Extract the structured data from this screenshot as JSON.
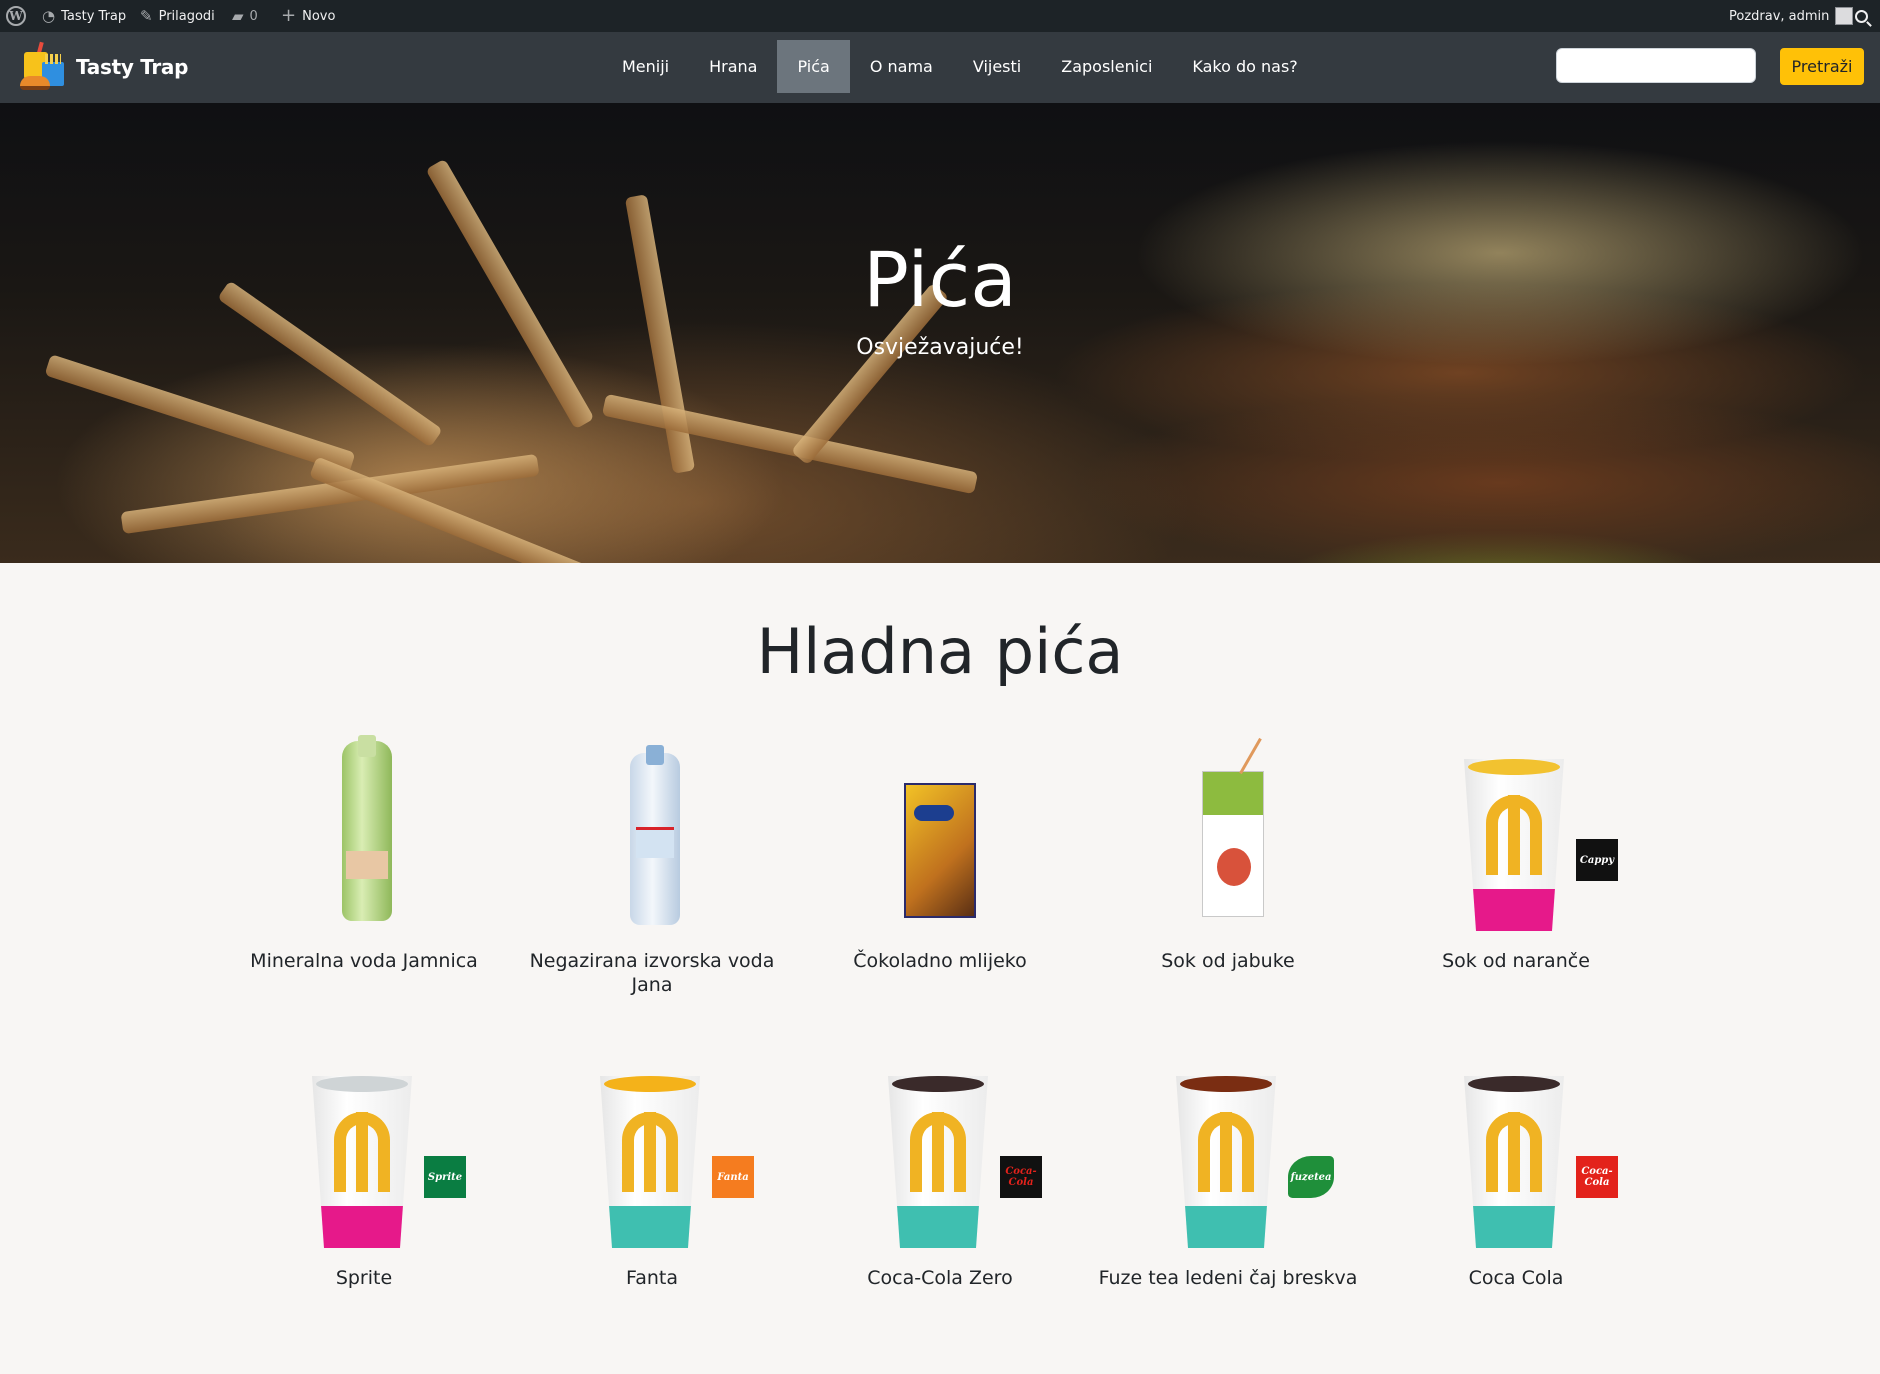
{
  "adminbar": {
    "site_name": "Tasty Trap",
    "customize": "Prilagodi",
    "comments_count": "0",
    "new": "Novo",
    "greeting": "Pozdrav, admin"
  },
  "navbar": {
    "brand": "Tasty Trap",
    "menu": [
      {
        "label": "Meniji",
        "active": false
      },
      {
        "label": "Hrana",
        "active": false
      },
      {
        "label": "Pića",
        "active": true
      },
      {
        "label": "O nama",
        "active": false
      },
      {
        "label": "Vijesti",
        "active": false
      },
      {
        "label": "Zaposlenici",
        "active": false
      },
      {
        "label": "Kako do nas?",
        "active": false
      }
    ],
    "search_value": "",
    "search_button": "Pretraži"
  },
  "hero": {
    "title": "Pića",
    "subtitle": "Osvježavajuće!"
  },
  "section": {
    "title": "Hladna pića",
    "products": [
      {
        "name": "Mineralna voda Jamnica",
        "image": "bottle-green"
      },
      {
        "name": "Negazirana izvorska voda Jana",
        "image": "bottle-clear"
      },
      {
        "name": "Čokoladno mlijeko",
        "image": "carton-choc"
      },
      {
        "name": "Sok od jabuke",
        "image": "carton-apple"
      },
      {
        "name": "Sok od naranče",
        "image": "cup",
        "lid": "#f2c230",
        "band": "#e6198a",
        "brand_bg": "#111111",
        "brand_fg": "#ffffff",
        "brand_text": "Cappy"
      },
      {
        "name": "Sprite",
        "image": "cup",
        "lid": "#cfd4d6",
        "band": "#e6198a",
        "brand_bg": "#0a7d42",
        "brand_fg": "#ffffff",
        "brand_text": "Sprite"
      },
      {
        "name": "Fanta",
        "image": "cup",
        "lid": "#f4b21a",
        "band": "#3fbfb0",
        "brand_bg": "#f57c1f",
        "brand_fg": "#ffffff",
        "brand_text": "Fanta"
      },
      {
        "name": "Coca-Cola Zero",
        "image": "cup",
        "lid": "#3a2a2a",
        "band": "#3fbfb0",
        "brand_bg": "#111111",
        "brand_fg": "#e3221b",
        "brand_text": "Coca-Cola"
      },
      {
        "name": "Fuze tea ledeni čaj breskva",
        "image": "cup",
        "lid": "#7a2d12",
        "band": "#3fbfb0",
        "brand_bg": "#1f8f3a",
        "brand_fg": "#ffffff",
        "brand_text": "fuzetea"
      },
      {
        "name": "Coca Cola",
        "image": "cup",
        "lid": "#3a2a2a",
        "band": "#3fbfb0",
        "brand_bg": "#e3221b",
        "brand_fg": "#ffffff",
        "brand_text": "Coca-Cola"
      }
    ]
  }
}
